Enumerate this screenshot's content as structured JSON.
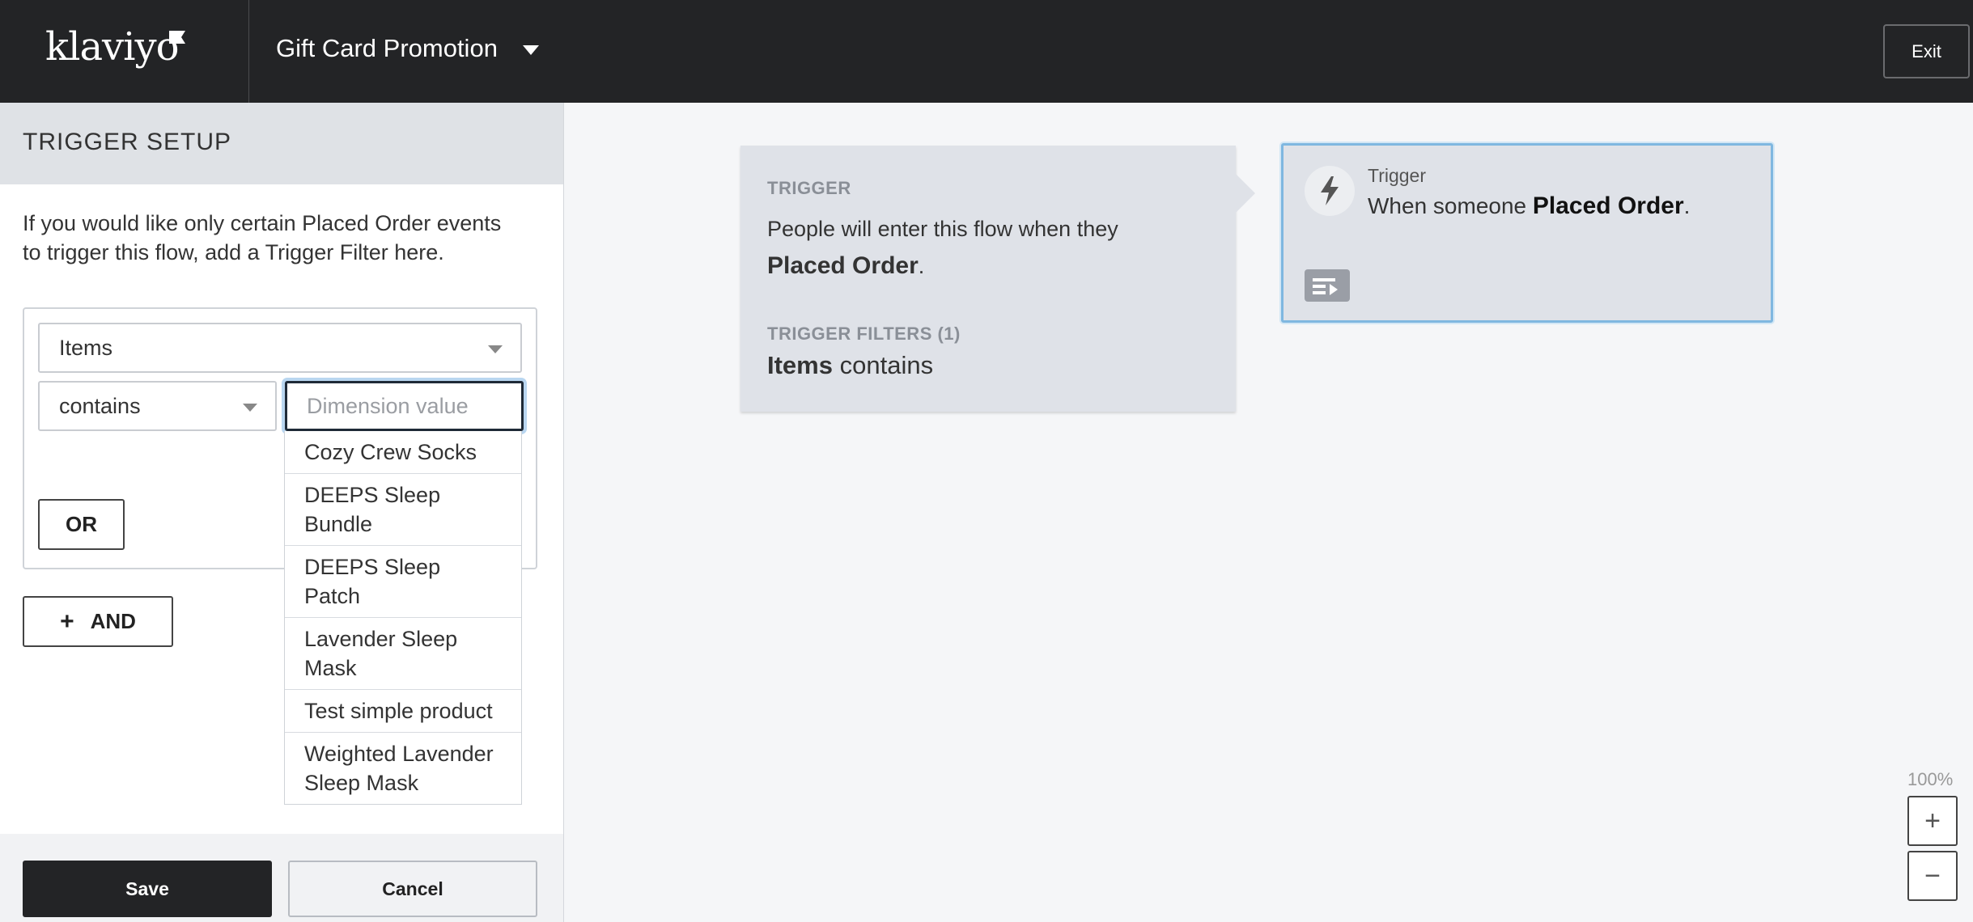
{
  "header": {
    "logo_text": "klaviyo",
    "flow_title": "Gift Card Promotion",
    "exit_label": "Exit"
  },
  "trigger_setup": {
    "title": "TRIGGER SETUP",
    "intro": "If you would like only certain Placed Order events to trigger this flow, add a Trigger Filter here.",
    "dimension_selected": "Items",
    "operator_selected": "contains",
    "value_placeholder": "Dimension value",
    "dropdown_options": [
      "Cozy Crew Socks",
      "DEEPS Sleep Bundle",
      "DEEPS Sleep Patch",
      "Lavender Sleep Mask",
      "Test simple product",
      "Weighted Lavender Sleep Mask"
    ],
    "or_label": "OR",
    "and_label": "AND",
    "save_label": "Save",
    "cancel_label": "Cancel"
  },
  "trigger_card": {
    "label": "TRIGGER",
    "text_prefix": "People will enter this flow when they",
    "metric": "Placed Order",
    "period": ".",
    "filters_label": "TRIGGER FILTERS (1)",
    "filter_dimension": "Items",
    "filter_operator": "contains"
  },
  "trigger_node": {
    "label": "Trigger",
    "text_prefix": "When someone",
    "metric": "Placed Order",
    "period": "."
  },
  "zoom": {
    "level": "100%",
    "in_label": "+",
    "out_label": "−"
  }
}
